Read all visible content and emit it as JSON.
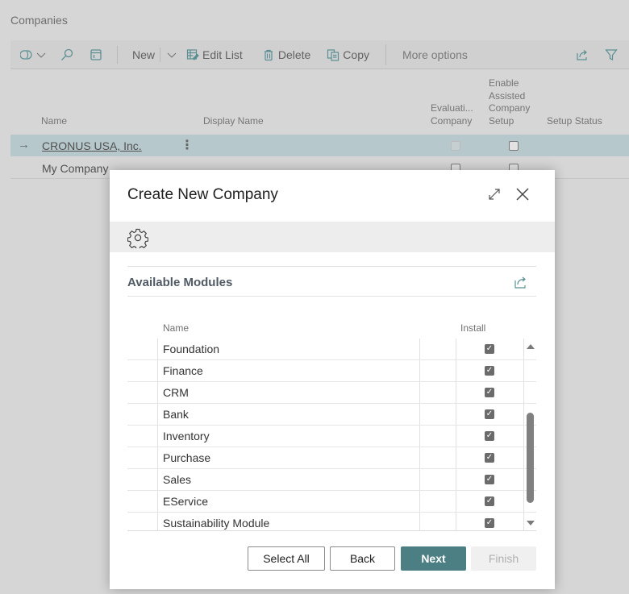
{
  "page": {
    "title": "Companies"
  },
  "toolbar": {
    "icons": [
      "copilot-icon",
      "search-icon",
      "layout-icon"
    ],
    "new_label": "New",
    "edit_list_label": "Edit List",
    "delete_label": "Delete",
    "copy_label": "Copy",
    "more_options_label": "More options"
  },
  "list": {
    "columns": {
      "name": "Name",
      "display_name": "Display Name",
      "evaluation_company": [
        "Evaluati...",
        "Company"
      ],
      "enable_assisted": [
        "Enable",
        "Assisted",
        "Company",
        "Setup"
      ],
      "setup_status": "Setup Status"
    },
    "rows": [
      {
        "name": "CRONUS USA, Inc.",
        "display_name": "",
        "evaluation_company": true,
        "enable_assisted_setup": false,
        "setup_status": "",
        "selected": true
      },
      {
        "name": "My Company",
        "display_name": "",
        "evaluation_company": false,
        "enable_assisted_setup": false,
        "setup_status": "",
        "selected": false
      }
    ]
  },
  "dialog": {
    "title": "Create New Company",
    "section_title": "Available Modules",
    "grid": {
      "columns": {
        "name": "Name",
        "install": "Install"
      },
      "rows": [
        {
          "name": "Foundation",
          "install": true
        },
        {
          "name": "Finance",
          "install": true
        },
        {
          "name": "CRM",
          "install": true
        },
        {
          "name": "Bank",
          "install": true
        },
        {
          "name": "Inventory",
          "install": true
        },
        {
          "name": "Purchase",
          "install": true
        },
        {
          "name": "Sales",
          "install": true
        },
        {
          "name": "EService",
          "install": true
        },
        {
          "name": "Sustainability Module",
          "install": true
        }
      ],
      "scroll_position": 0.6
    },
    "buttons": {
      "select_all": "Select All",
      "back": "Back",
      "next": "Next",
      "finish": "Finish"
    },
    "finish_enabled": false
  },
  "colors": {
    "accent": "#4b7f84",
    "selected_row": "#b6c8cc"
  }
}
